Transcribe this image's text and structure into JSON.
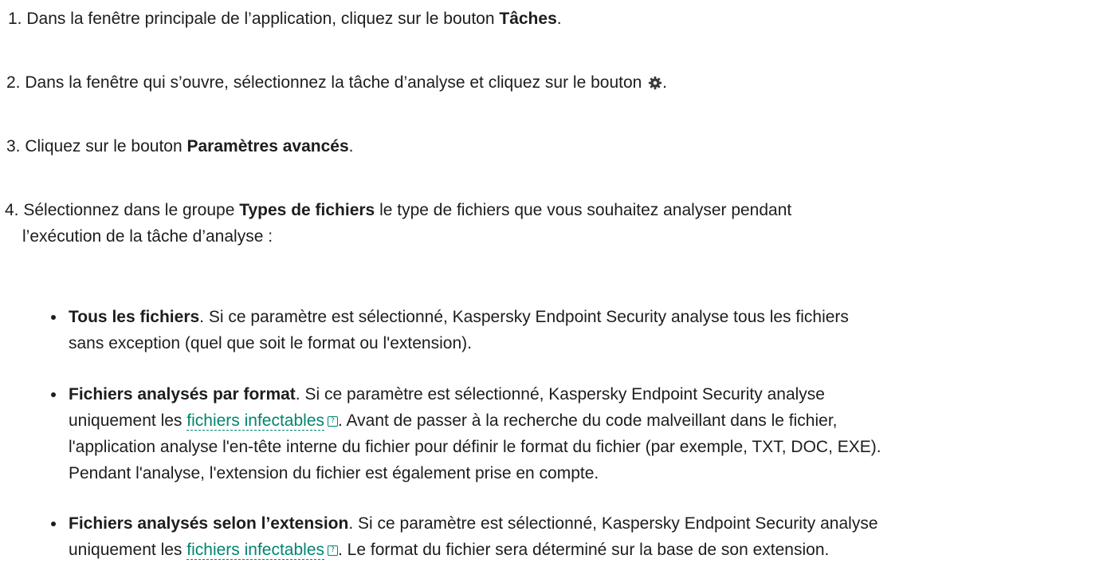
{
  "steps": [
    {
      "num": "1.",
      "pre": " Dans la fenêtre principale de l’application, cliquez sur le bouton ",
      "bold": "Tâches",
      "post": "."
    },
    {
      "num": "2.",
      "pre": " Dans la fenêtre qui s’ouvre, sélectionnez la tâche d’analyse et cliquez sur le bouton ",
      "icon": "gear-icon",
      "post": "."
    },
    {
      "num": "3.",
      "pre": " Cliquez sur le bouton ",
      "bold": "Paramètres avancés",
      "post": "."
    },
    {
      "num": "4.",
      "pre": " Sélectionnez dans le groupe ",
      "bold": "Types de fichiers",
      "post_line1": " le type de fichiers que vous souhaitez analyser pendant",
      "line2": "l’exécution de la tâche d’analyse :"
    }
  ],
  "options": [
    {
      "title": "Tous les fichiers",
      "line1": ". Si ce paramètre est sélectionné, Kaspersky Endpoint Security analyse tous les fichiers",
      "line2": "sans exception (quel que soit le format ou l'extension)."
    },
    {
      "title": "Fichiers analysés par format",
      "line1": ". Si ce paramètre est sélectionné, Kaspersky Endpoint Security analyse",
      "line2_pre": "uniquement les ",
      "link": "fichiers infectables",
      "line2_post": ". Avant de passer à la recherche du code malveillant dans le fichier,",
      "line3": "l'application analyse l'en-tête interne du fichier pour définir le format du fichier (par exemple, TXT, DOC, EXE).",
      "line4": "Pendant l'analyse, l'extension du fichier est également prise en compte."
    },
    {
      "title": "Fichiers analysés selon l’extension",
      "line1": ". Si ce paramètre est sélectionné, Kaspersky Endpoint Security analyse",
      "line2_pre": "uniquement les ",
      "link": "fichiers infectables",
      "line2_post": ". Le format du fichier sera déterminé sur la base de son extension."
    }
  ],
  "help_glyph": "?",
  "colors": {
    "text": "#1d1d1b",
    "link": "#00856f"
  }
}
